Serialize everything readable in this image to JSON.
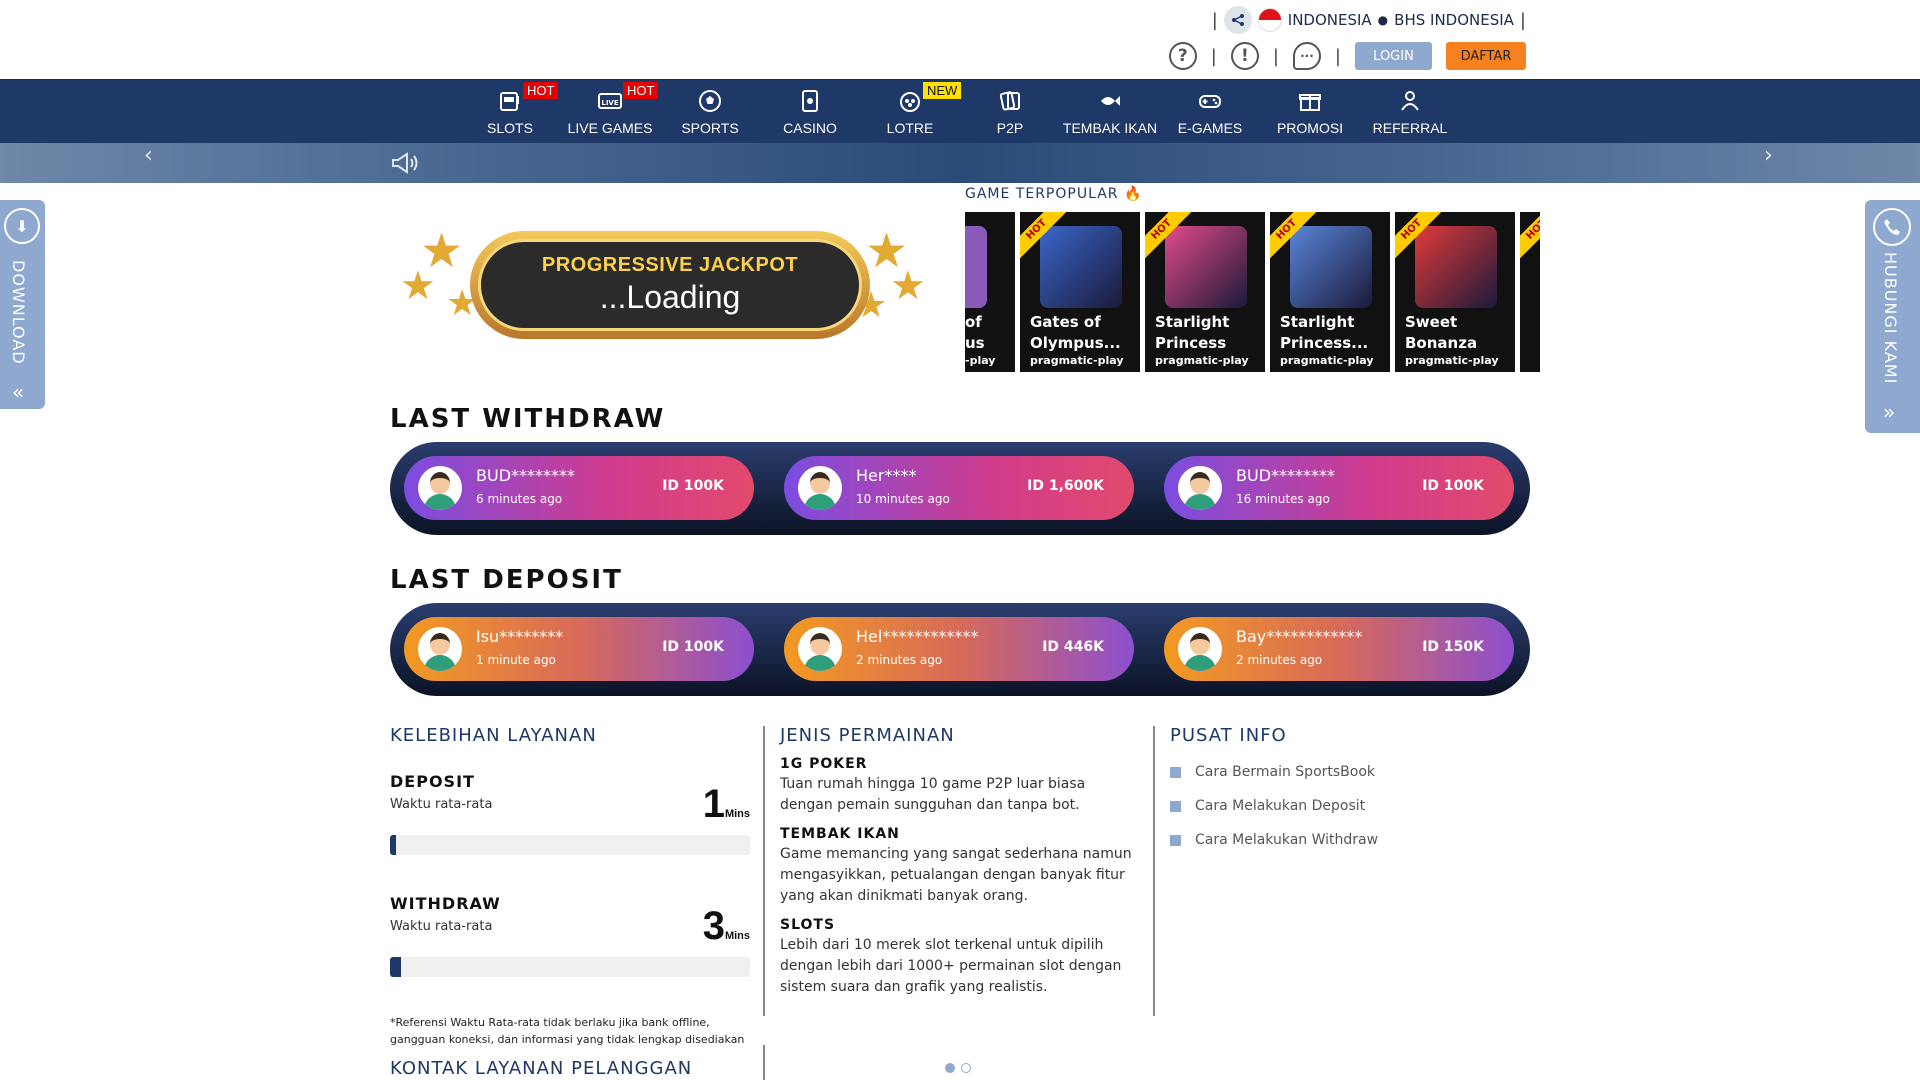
{
  "header": {
    "country": "INDONESIA",
    "language": "BHS INDONESIA",
    "login_label": "LOGIN",
    "daftar_label": "DAFTAR",
    "accent": "#1e3867",
    "login_color": "#8ea8cf",
    "daftar_color": "#f5821f"
  },
  "nav": {
    "items": [
      {
        "label": "SLOTS",
        "badge": "HOT",
        "icon": "slot-machine-icon"
      },
      {
        "label": "LIVE GAMES",
        "badge": "HOT",
        "icon": "live-icon"
      },
      {
        "label": "SPORTS",
        "badge": "",
        "icon": "soccer-ball-icon"
      },
      {
        "label": "CASINO",
        "badge": "",
        "icon": "cards-icon"
      },
      {
        "label": "LOTRE",
        "badge": "NEW",
        "icon": "lottery-icon"
      },
      {
        "label": "P2P",
        "badge": "",
        "icon": "p2p-cards-icon"
      },
      {
        "label": "TEMBAK IKAN",
        "badge": "",
        "icon": "fish-icon"
      },
      {
        "label": "E-GAMES",
        "badge": "",
        "icon": "gamepad-icon"
      },
      {
        "label": "PROMOSI",
        "badge": "",
        "icon": "gift-icon"
      },
      {
        "label": "REFERRAL",
        "badge": "",
        "icon": "referral-icon"
      }
    ]
  },
  "side": {
    "download": "DOWNLOAD",
    "contact": "HUBUNGI KAMI"
  },
  "jackpot": {
    "title": "PROGRESSIVE JACKPOT",
    "value": "...Loading"
  },
  "popular": {
    "title": "GAME TERPOPULAR",
    "partial_left": {
      "name": "of\nus",
      "provider": "-play"
    },
    "games": [
      {
        "name": "Gates of Olympus...",
        "provider": "pragmatic-play",
        "ribbon": "HOT",
        "color": "#3a66c9"
      },
      {
        "name": "Starlight Princess",
        "provider": "pragmatic-play",
        "ribbon": "HOT",
        "color": "#e24a8a"
      },
      {
        "name": "Starlight Princess...",
        "provider": "pragmatic-play",
        "ribbon": "HOT",
        "color": "#5a86d9"
      },
      {
        "name": "Sweet Bonanza",
        "provider": "pragmatic-play",
        "ribbon": "HOT",
        "color": "#e23a3a"
      }
    ],
    "partial_right": {
      "ribbon": "HOT"
    }
  },
  "withdraw": {
    "title": "LAST WITHDRAW",
    "entries": [
      {
        "name": "BUD********",
        "time": "6 minutes ago",
        "amount": "ID 100K"
      },
      {
        "name": "Her****",
        "time": "10 minutes ago",
        "amount": "ID 1,600K"
      },
      {
        "name": "BUD********",
        "time": "16 minutes ago",
        "amount": "ID 100K"
      }
    ]
  },
  "deposit": {
    "title": "LAST DEPOSIT",
    "entries": [
      {
        "name": "Isu********",
        "time": "1 minute ago",
        "amount": "ID 100K"
      },
      {
        "name": "Hel************",
        "time": "2 minutes ago",
        "amount": "ID 446K"
      },
      {
        "name": "Bay************",
        "time": "2 minutes ago",
        "amount": "ID 150K"
      }
    ]
  },
  "services": {
    "title": "KELEBIHAN LAYANAN",
    "deposit": {
      "label": "DEPOSIT",
      "sub": "Waktu rata-rata",
      "value": "1",
      "unit": "Mins",
      "progress": 0.01
    },
    "withdraw": {
      "label": "WITHDRAW",
      "sub": "Waktu rata-rata",
      "value": "3",
      "unit": "Mins",
      "progress": 0.03
    },
    "note": "*Referensi Waktu Rata-rata tidak berlaku jika bank offline, gangguan koneksi, dan informasi yang tidak lengkap disediakan",
    "contact_title": "KONTAK LAYANAN PELANGGAN"
  },
  "games_info": {
    "title": "JENIS PERMAINAN",
    "items": [
      {
        "title": "1G POKER",
        "desc": "Tuan rumah hingga 10 game P2P luar biasa dengan pemain sungguhan dan tanpa bot."
      },
      {
        "title": "TEMBAK IKAN",
        "desc": "Game memancing yang sangat sederhana namun mengasyikkan, petualangan dengan banyak fitur yang akan dinikmati banyak orang."
      },
      {
        "title": "SLOTS",
        "desc": "Lebih dari 10 merek slot terkenal untuk dipilih dengan lebih dari 1000+ permainan slot dengan sistem suara dan grafik yang realistis."
      }
    ]
  },
  "info_center": {
    "title": "PUSAT INFO",
    "links": [
      "Cara Bermain SportsBook",
      "Cara Melakukan Deposit",
      "Cara Melakukan Withdraw"
    ]
  }
}
